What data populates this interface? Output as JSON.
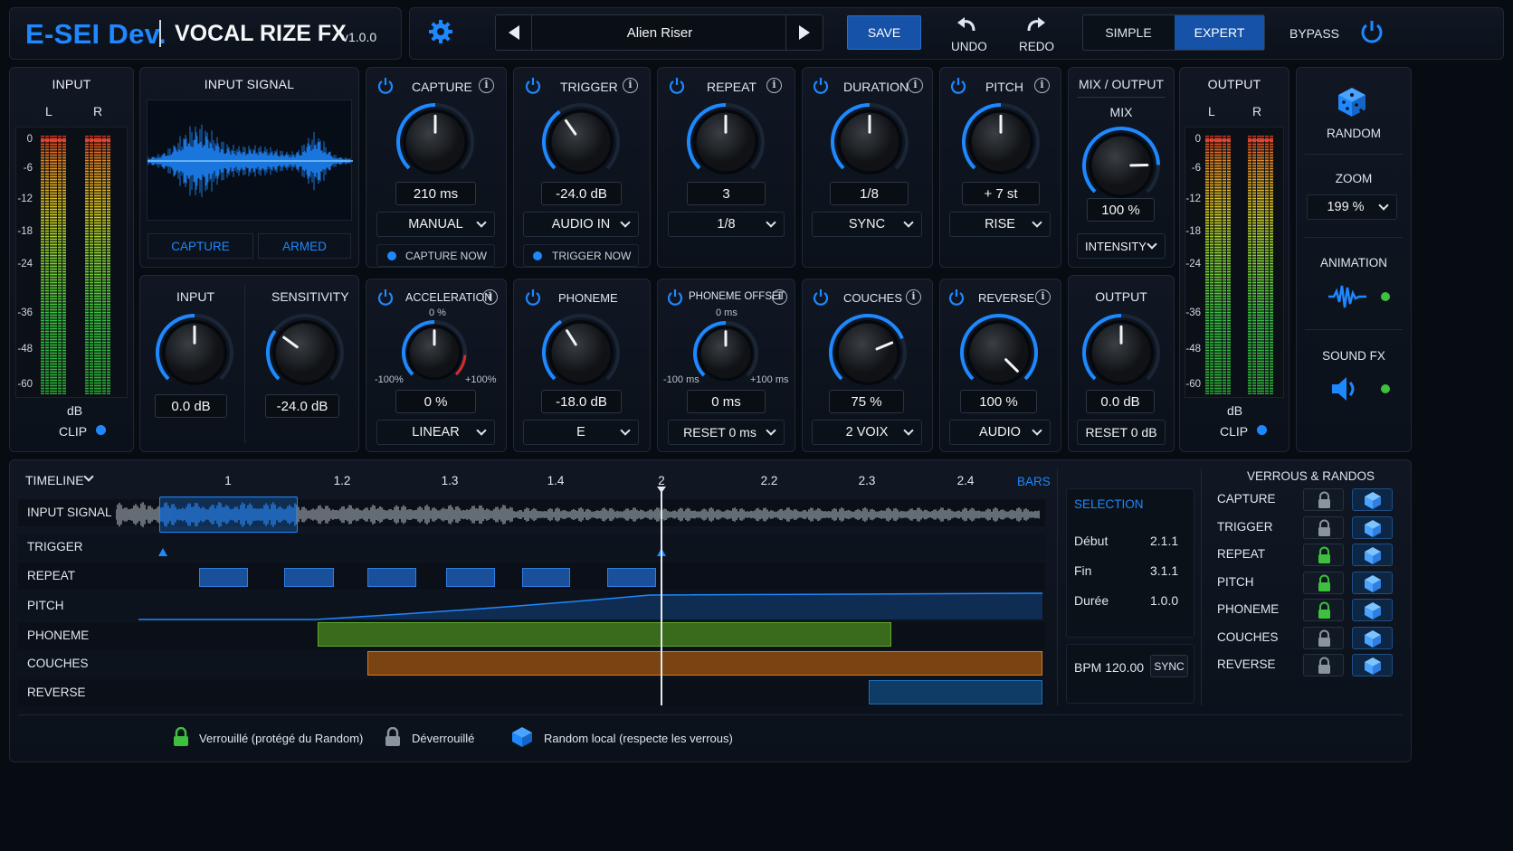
{
  "header": {
    "brand": "E-SEI Dev.",
    "product": "VOCAL RIZE FX",
    "version": "v1.0.0",
    "preset": "Alien Riser",
    "save": "SAVE",
    "undo": "UNDO",
    "redo": "REDO",
    "mode_simple": "SIMPLE",
    "mode_expert": "EXPERT",
    "bypass": "BYPASS"
  },
  "input_meter": {
    "title": "INPUT",
    "left": "L",
    "right": "R",
    "scale": [
      "0",
      "-6",
      "-12",
      "-18",
      "-24",
      "-36",
      "-48",
      "-60"
    ],
    "unit": "dB",
    "clip": "CLIP"
  },
  "output_meter": {
    "title": "OUTPUT",
    "left": "L",
    "right": "R",
    "scale": [
      "0",
      "-6",
      "-12",
      "-18",
      "-24",
      "-36",
      "-48",
      "-60"
    ],
    "unit": "dB",
    "clip": "CLIP"
  },
  "input_signal": {
    "title": "INPUT SIGNAL",
    "capture": "CAPTURE",
    "armed": "ARMED"
  },
  "input_section": {
    "input_label": "INPUT",
    "input_value": "0.0 dB",
    "sens_label": "SENSITIVITY",
    "sens_value": "-24.0 dB"
  },
  "capture": {
    "title": "CAPTURE",
    "value": "210 ms",
    "mode": "MANUAL",
    "action": "CAPTURE NOW"
  },
  "trigger": {
    "title": "TRIGGER",
    "value": "-24.0 dB",
    "mode": "AUDIO IN",
    "action": "TRIGGER NOW"
  },
  "repeat": {
    "title": "REPEAT",
    "value": "3",
    "mode": "1/8"
  },
  "duration": {
    "title": "DURATION",
    "value": "1/8",
    "mode": "SYNC"
  },
  "pitch": {
    "title": "PITCH",
    "value": "+ 7 st",
    "mode": "RISE"
  },
  "mix": {
    "title": "MIX / OUTPUT",
    "label": "MIX",
    "value": "100 %",
    "mode": "INTENSITY"
  },
  "acceleration": {
    "title": "ACCELERATION",
    "top": "0 %",
    "min": "-100%",
    "max": "+100%",
    "value": "0 %",
    "mode": "LINEAR"
  },
  "phoneme": {
    "title": "PHONEME",
    "value": "-18.0 dB",
    "mode": "E"
  },
  "phoneme_offset": {
    "title": "PHONEME OFFSET",
    "top": "0 ms",
    "min": "-100 ms",
    "max": "+100 ms",
    "value": "0 ms",
    "mode": "RESET 0 ms"
  },
  "couches": {
    "title": "COUCHES",
    "value": "75 %",
    "mode": "2 VOIX"
  },
  "reverse": {
    "title": "REVERSE",
    "value": "100 %",
    "mode": "AUDIO"
  },
  "output": {
    "title": "OUTPUT",
    "value": "0.0 dB",
    "reset": "RESET 0 dB"
  },
  "side": {
    "random": "RANDOM",
    "zoom": "ZOOM",
    "zoom_value": "199 %",
    "animation": "ANIMATION",
    "sound_fx": "SOUND FX"
  },
  "timeline": {
    "title": "TIMELINE",
    "bars": [
      "1",
      "1.2",
      "1.3",
      "1.4",
      "2",
      "2.2",
      "2.3",
      "2.4"
    ],
    "unit": "BARS",
    "rows": [
      "INPUT SIGNAL",
      "TRIGGER",
      "REPEAT",
      "PITCH",
      "PHONEME",
      "COUCHES",
      "REVERSE"
    ]
  },
  "selection": {
    "title": "SELECTION",
    "start_label": "Début",
    "start": "2.1.1",
    "end_label": "Fin",
    "end": "3.1.1",
    "dur_label": "Durée",
    "dur": "1.0.0",
    "bpm": "BPM 120.00",
    "sync": "SYNC"
  },
  "locks": {
    "title": "VERROUS & RANDOS",
    "items": [
      {
        "label": "CAPTURE",
        "locked": false
      },
      {
        "label": "TRIGGER",
        "locked": false
      },
      {
        "label": "REPEAT",
        "locked": true
      },
      {
        "label": "PITCH",
        "locked": true
      },
      {
        "label": "PHONEME",
        "locked": true
      },
      {
        "label": "COUCHES",
        "locked": false
      },
      {
        "label": "REVERSE",
        "locked": false
      }
    ]
  },
  "legend": {
    "locked": "Verrouillé (protégé du Random)",
    "unlocked": "Déverrouillé",
    "random": "Random local (respecte les verrous)"
  },
  "colors": {
    "accent": "#1e88ff",
    "green": "#3ec03e",
    "orange": "#c9721c",
    "bg": "#070b12"
  }
}
